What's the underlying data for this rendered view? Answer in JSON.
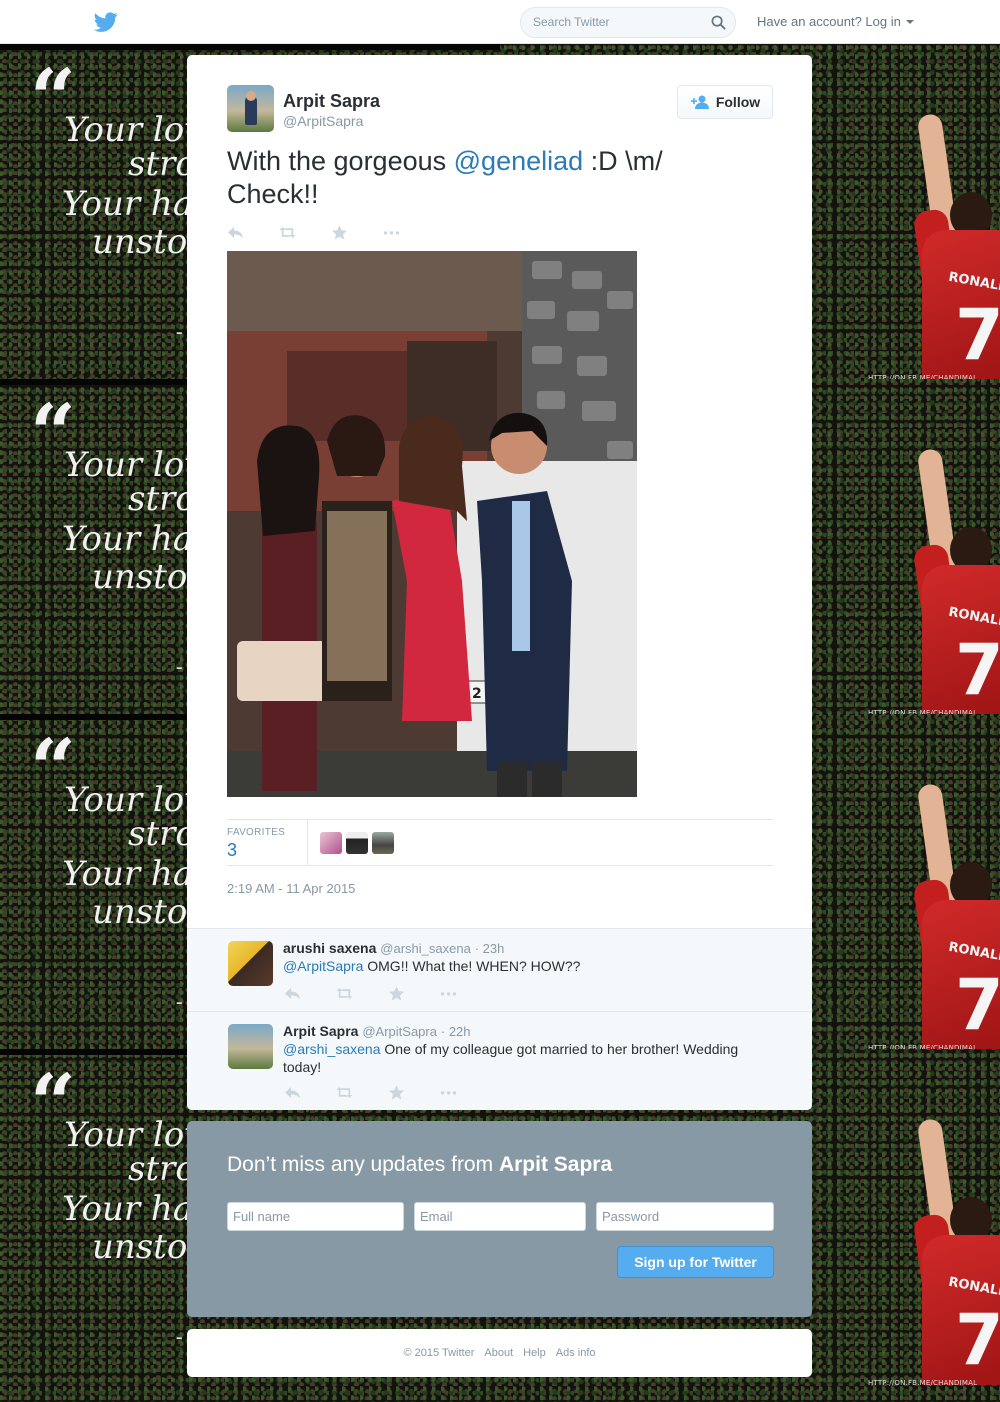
{
  "header": {
    "search_placeholder": "Search Twitter",
    "account_prompt": "Have an account?",
    "login_label": "Log in"
  },
  "tweet": {
    "author_name": "Arpit Sapra",
    "author_handle": "@ArpitSapra",
    "follow_label": "Follow",
    "text_before": "With the gorgeous ",
    "mention": "@geneliad",
    "text_after": " :D \\m/ Check!!",
    "favorites_label": "FAVORITES",
    "favorites_count": "3",
    "timestamp": "2:19 AM - 11 Apr 2015"
  },
  "photo": {
    "plate_text": "2 DJ 25"
  },
  "replies": [
    {
      "name": "arushi saxena",
      "handle": "@arshi_saxena",
      "time": "· 23h",
      "mention": "@ArpitSapra",
      "text": " OMG!! What the! WHEN? HOW??"
    },
    {
      "name": "Arpit Sapra",
      "handle": "@ArpitSapra",
      "time": "· 22h",
      "mention": "@arshi_saxena",
      "text": "  One of my colleague got married to her brother! Wedding today!"
    }
  ],
  "signup": {
    "title_prefix": "Don’t miss any updates from ",
    "title_name": "Arpit Sapra",
    "full_name_placeholder": "Full name",
    "email_placeholder": "Email",
    "password_placeholder": "Password",
    "button_label": "Sign up for Twitter"
  },
  "footer": {
    "copyright": "© 2015 Twitter",
    "links": [
      "About",
      "Help",
      "Ads info"
    ]
  },
  "background": {
    "quote_lines": [
      "Your love i",
      "stron",
      "Your hate i",
      "unstopp"
    ],
    "quote_author": "– Cr",
    "watermark": "HTTP://ON.FB.ME/CHANDIMAL",
    "jersey_name": "RONALDO",
    "jersey_number": "7"
  },
  "colors": {
    "brand_blue": "#55acee",
    "link_blue": "#2b7bb9",
    "signup_bg": "#8899a6"
  },
  "icons": [
    "twitter-bird-icon",
    "search-icon",
    "caret-down-icon",
    "follow-user-icon",
    "reply-icon",
    "retweet-icon",
    "favorite-star-icon",
    "more-dots-icon"
  ]
}
